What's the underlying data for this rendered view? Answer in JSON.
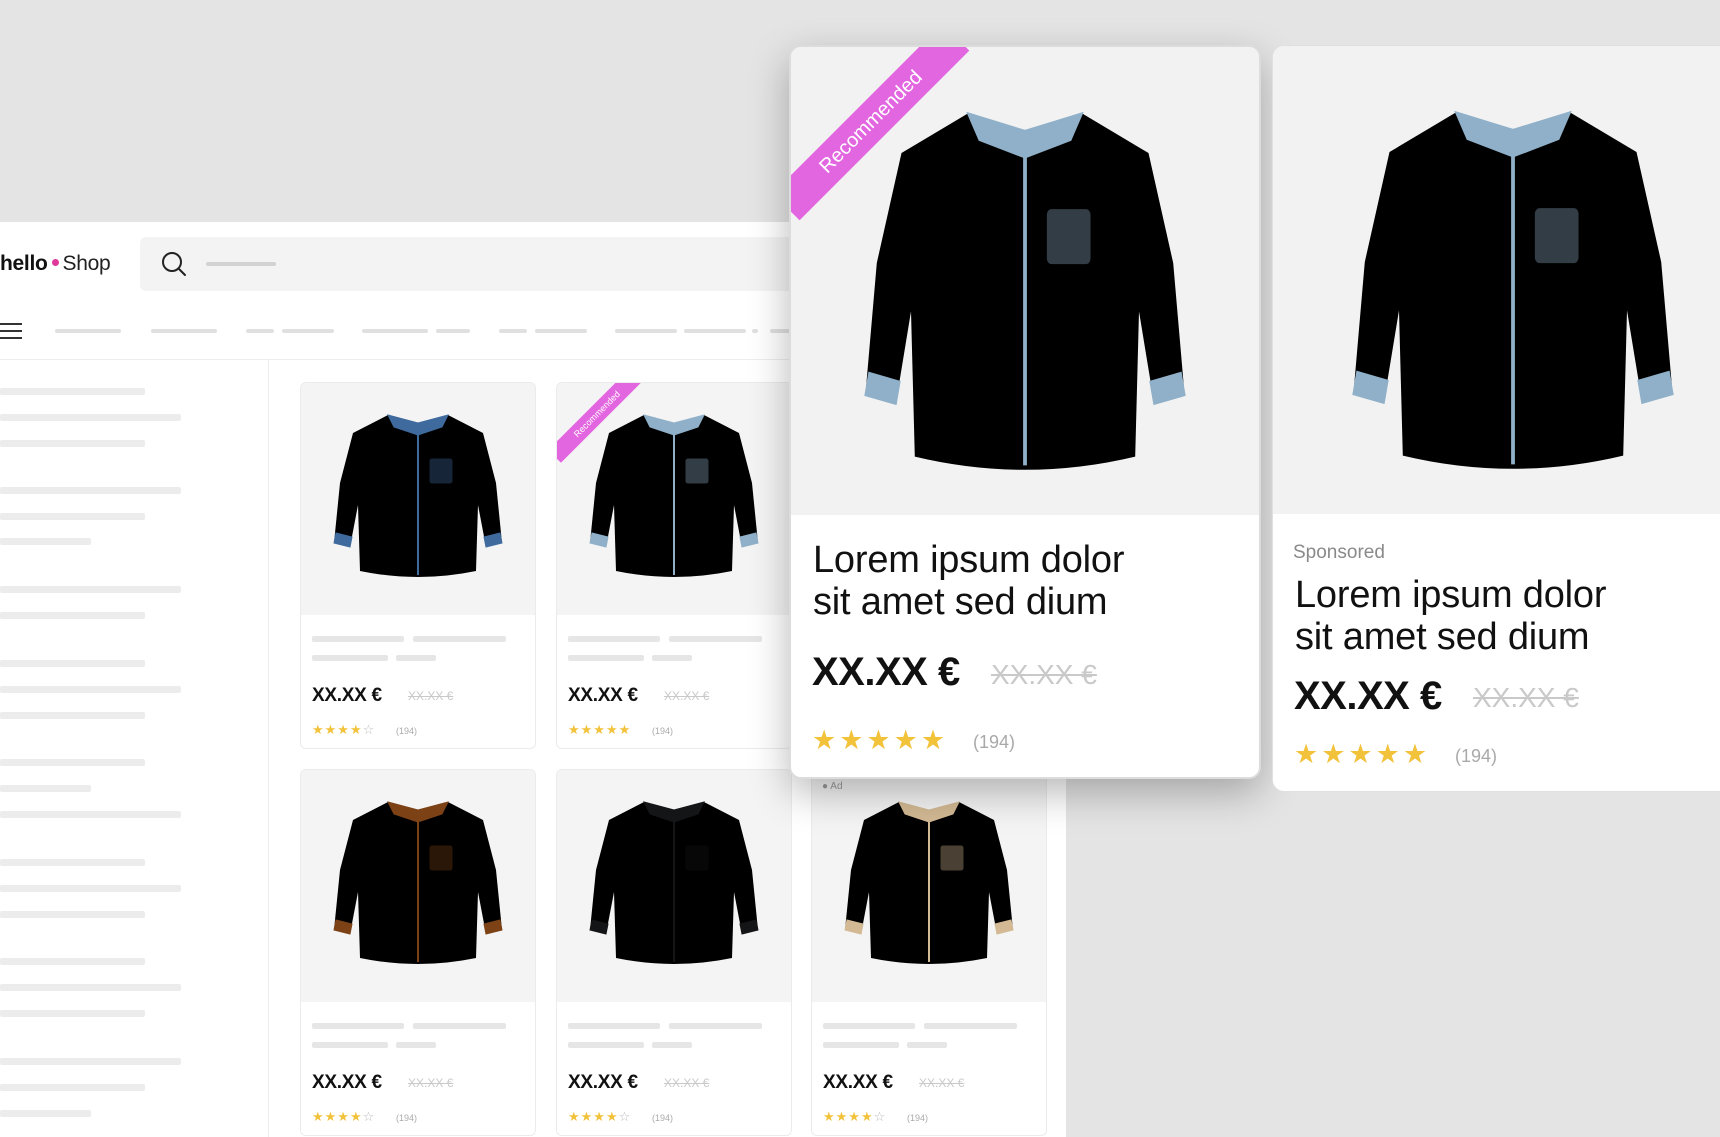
{
  "brand": {
    "part1": "hello",
    "part2": "Shop",
    "dot_color": "#e0389a"
  },
  "icons": {
    "search": "search-icon",
    "menu": "menu-icon",
    "ad": "info-icon"
  },
  "colors": {
    "ribbon": "#e366e1",
    "star": "#f2c23b"
  },
  "products": [
    {
      "color": "#6d97c9",
      "shade": "#3f6a9e",
      "price": "XX.XX €",
      "old_price": "XX.XX €",
      "stars": "★★★★",
      "stars_off": "☆",
      "reviews": "(194)",
      "rating": 4
    },
    {
      "color": "#c3d5e3",
      "shade": "#8fb0c8",
      "ribbon": "Recommended",
      "price": "XX.XX €",
      "old_price": "XX.XX €",
      "stars": "★★★★★",
      "stars_off": "",
      "reviews": "(194)",
      "rating": 5
    },
    {
      "color": "#b56a2c",
      "shade": "#7c4216",
      "price": "XX.XX €",
      "old_price": "XX.XX €",
      "stars": "★★★★",
      "stars_off": "☆",
      "reviews": "(194)",
      "rating": 4
    },
    {
      "color": "#2c2e31",
      "shade": "#141517",
      "price": "XX.XX €",
      "old_price": "XX.XX €",
      "stars": "★★★★",
      "stars_off": "☆",
      "reviews": "(194)",
      "rating": 4
    },
    {
      "color": "#f0dcc0",
      "shade": "#d3b994",
      "ad": "Ad",
      "price": "XX.XX €",
      "old_price": "XX.XX €",
      "stars": "★★★★",
      "stars_off": "☆",
      "reviews": "(194)",
      "rating": 4
    }
  ],
  "featured": {
    "ribbon": "Recommended",
    "title_line1": "Lorem ipsum dolor",
    "title_line2": "sit amet sed dium",
    "price": "XX.XX €",
    "old_price": "XX.XX €",
    "stars": "★★★★★",
    "reviews": "(194)",
    "rating": 5
  },
  "sponsored_card": {
    "label": "Sponsored",
    "title_line1": "Lorem ipsum dolor",
    "title_line2": "sit amet sed dium",
    "price": "XX.XX €",
    "old_price": "XX.XX €",
    "stars": "★★★★★",
    "reviews": "(194)",
    "rating": 5
  }
}
